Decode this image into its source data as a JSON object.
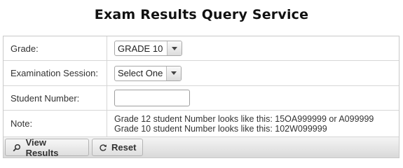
{
  "page": {
    "title": "Exam Results Query Service"
  },
  "form": {
    "grade": {
      "label": "Grade:",
      "value": "GRADE 10"
    },
    "session": {
      "label": "Examination Session:",
      "value": "Select One"
    },
    "student": {
      "label": "Student Number:",
      "value": "",
      "placeholder": ""
    },
    "note": {
      "label": "Note:",
      "line1": "Grade 12 student Number looks like this: 15OA999999 or A099999",
      "line2": "Grade 10 student Number looks like this: 102W099999"
    }
  },
  "toolbar": {
    "view_label": "View Results",
    "view_icon": "search-icon",
    "reset_label": "Reset",
    "reset_icon": "refresh-icon"
  }
}
